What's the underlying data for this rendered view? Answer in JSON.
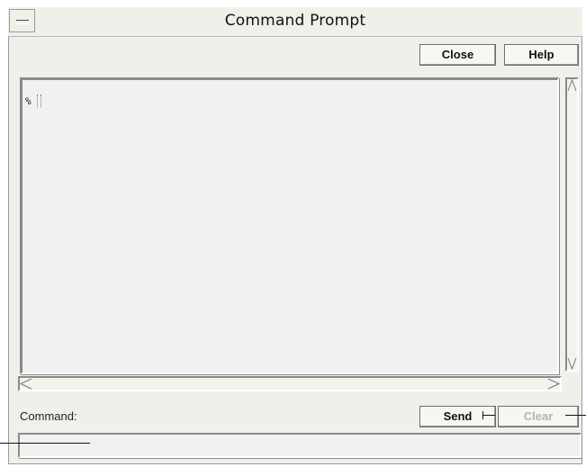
{
  "window": {
    "title": "Command Prompt"
  },
  "toolbar": {
    "close_label": "Close",
    "help_label": "Help"
  },
  "output": {
    "prompt": "%"
  },
  "command": {
    "label": "Command:",
    "value": "",
    "send_label": "Send",
    "clear_label": "Clear"
  },
  "icons": {
    "menu": "window-menu-icon",
    "scroll_up": "scroll-up-arrow-icon",
    "scroll_down": "scroll-down-arrow-icon",
    "scroll_left": "scroll-left-arrow-icon",
    "scroll_right": "scroll-right-arrow-icon"
  }
}
